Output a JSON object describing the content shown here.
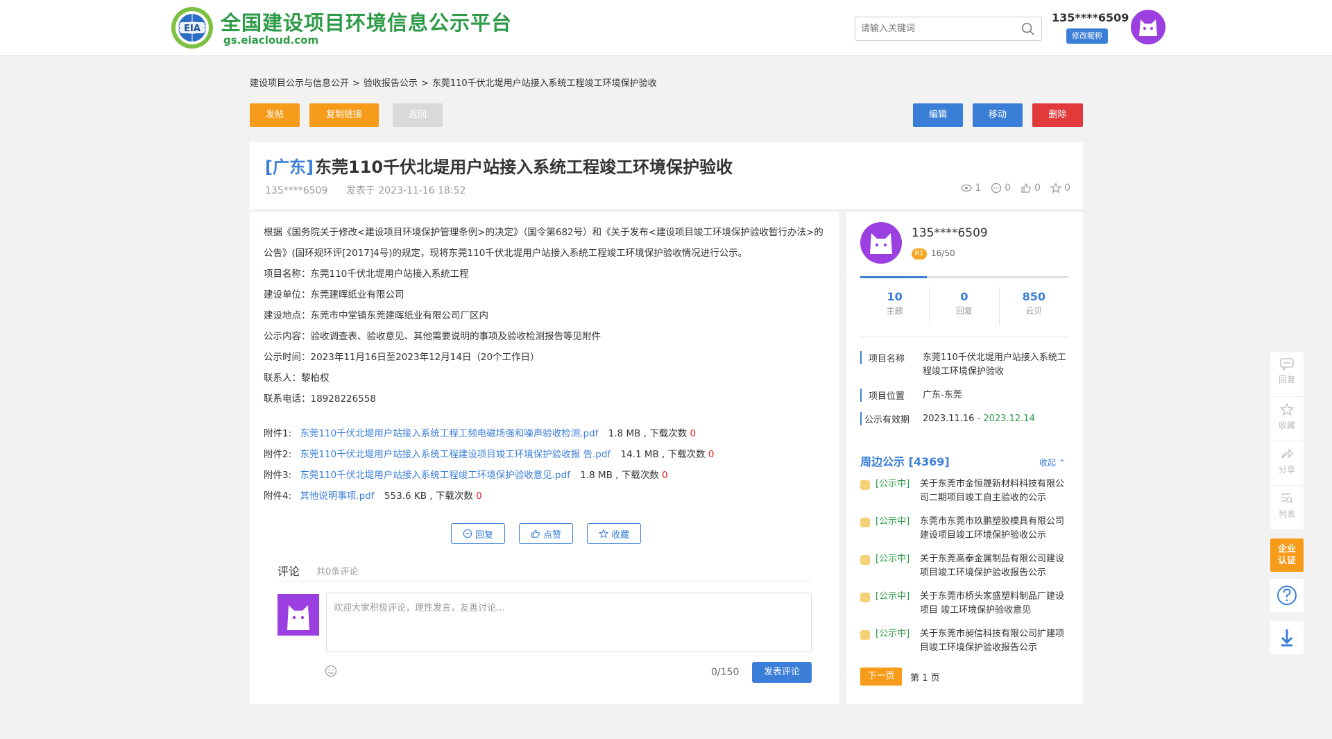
{
  "header": {
    "logo_text": "EIA",
    "site_title": "全国建设项目环境信息公示平台",
    "site_url": "gs.eiacloud.com",
    "search_placeholder": "请输入关键词",
    "username": "135****6509",
    "rename_label": "修改昵称"
  },
  "breadcrumb": {
    "items": [
      "建设项目公示与信息公开",
      "验收报告公示",
      "东莞110千伏北堤用户站接入系统工程竣工环境保护验收"
    ],
    "separator": ">"
  },
  "toolbar": {
    "post_label": "发帖",
    "copy_label": "复制链接",
    "back_label": "返回",
    "edit_label": "编辑",
    "move_label": "移动",
    "delete_label": "删除"
  },
  "post": {
    "region": "[广东]",
    "title": "东莞110千伏北堤用户站接入系统工程竣工环境保护验收",
    "author": "135****6509",
    "published": "发表于 2023-11-16 18:52",
    "views": "1",
    "comments": "0",
    "likes": "0",
    "favorites": "0"
  },
  "content": {
    "para1": "根据《国务院关于修改<建设项目环境保护管理条例>的决定》（国令第682号）和《关于发布<建设项目竣工环境保护验收暂行办法>的公告》(国环规环评[2017]4号)的规定，现将东莞110千伏北堤用户站接入系统工程竣工环境保护验收情况进行公示。",
    "lines": [
      "项目名称：东莞110千伏北堤用户站接入系统工程",
      "建设单位：东莞建晖纸业有限公司",
      "建设地点：东莞市中堂镇东莞建晖纸业有限公司厂区内",
      "公示内容：验收调查表、验收意见、其他需要说明的事项及验收检测报告等见附件",
      "公示时间：2023年11月16日至2023年12月14日（20个工作日）",
      "联系人：黎柏权",
      "联系电话：18928226558"
    ],
    "attachments": [
      {
        "label": "附件1:",
        "name": "东莞110千伏北堤用户站接入系统工程工频电磁场强和噪声验收检测.pdf",
        "size": "1.8 MB , 下载次数",
        "count": "0"
      },
      {
        "label": "附件2:",
        "name": "东莞110千伏北堤用户站接入系统工程建设项目竣工环境保护验收报 告.pdf",
        "size": "14.1 MB , 下载次数",
        "count": "0"
      },
      {
        "label": "附件3:",
        "name": "东莞110千伏北堤用户站接入系统工程竣工环境保护验收意见.pdf",
        "size": "1.8 MB , 下载次数",
        "count": "0"
      },
      {
        "label": "附件4:",
        "name": "其他说明事项.pdf",
        "size": "553.6 KB , 下载次数",
        "count": "0"
      }
    ]
  },
  "actions": {
    "reply_label": "回复",
    "like_label": "点赞",
    "favorite_label": "收藏"
  },
  "comments": {
    "title": "评论",
    "count_text": "共0条评论",
    "placeholder": "欢迎大家积极评论，理性发言，友善讨论...",
    "counter": "0/150",
    "submit_label": "发表评论"
  },
  "sidebar": {
    "username": "135****6509",
    "level": "R1",
    "level_progress": "16/50",
    "level_fraction": 0.32,
    "stats": [
      {
        "value": "10",
        "label": "主题"
      },
      {
        "value": "0",
        "label": "回复"
      },
      {
        "value": "850",
        "label": "云贝"
      }
    ],
    "project_name_key": "项目名称",
    "project_name": "东莞110千伏北堤用户站接入系统工程竣工环境保护验收",
    "project_location_key": "项目位置",
    "project_location": "广东-东莞",
    "valid_key": "公示有效期",
    "valid_start": "2023.11.16",
    "valid_sep": " - ",
    "valid_end": "2023.12.14",
    "nearby_title": "周边公示 [4369]",
    "collapse_label": "收起",
    "nearby": [
      {
        "status": "[公示中]",
        "text": "关于东莞市金恒晟新材料科技有限公司二期项目竣工自主验收的公示"
      },
      {
        "status": "[公示中]",
        "text": "东莞市东莞市玖鹏塑胶模具有限公司建设项目竣工环境保护验收公示"
      },
      {
        "status": "[公示中]",
        "text": "关于东莞高泰金属制品有限公司建设项目竣工环境保护验收报告公示"
      },
      {
        "status": "[公示中]",
        "text": "关于东莞市桥头家盛塑料制品厂建设项目 竣工环境保护验收意见"
      },
      {
        "status": "[公示中]",
        "text": "关于东莞市昶信科技有限公司扩建项目竣工环境保护验收报告公示"
      }
    ],
    "next_label": "下一页",
    "page_text": "第 1 页"
  },
  "float_panel": {
    "reply": "回复",
    "favorite": "收藏",
    "share": "分享",
    "list": "列表",
    "cert_line1": "企业",
    "cert_line2": "认证"
  },
  "colors": {
    "brand_green": "#2e9b48",
    "accent_blue": "#3a7ed8",
    "orange": "#f79b1a",
    "red": "#e03a3a",
    "avatar_purple": "#9b3fe0"
  }
}
